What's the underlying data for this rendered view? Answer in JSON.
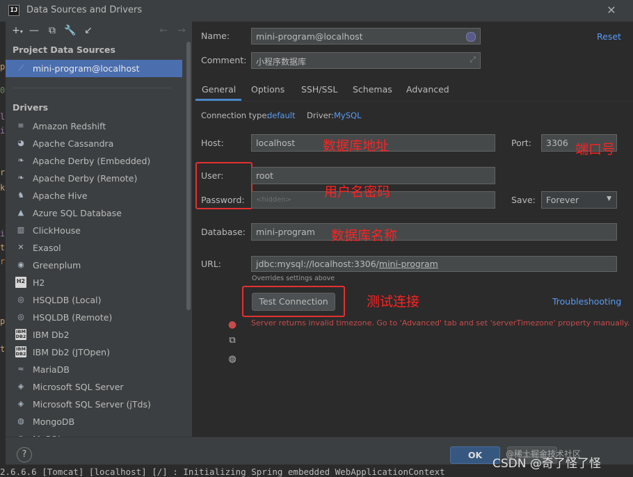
{
  "window": {
    "title": "Data Sources and Drivers",
    "logo": "IJ",
    "close_glyph": "✕"
  },
  "toolbar": {
    "add": "+",
    "add_arrow": "▾",
    "remove": "—",
    "copy": "⧉",
    "settings": "🔧",
    "import": "↙",
    "back": "←",
    "forward": "→"
  },
  "left": {
    "project_title": "Project Data Sources",
    "project_item": "mini-program@localhost",
    "drivers_title": "Drivers",
    "drivers": [
      {
        "label": "Amazon Redshift",
        "icon": "≡"
      },
      {
        "label": "Apache Cassandra",
        "icon": "◕"
      },
      {
        "label": "Apache Derby (Embedded)",
        "icon": "❧"
      },
      {
        "label": "Apache Derby (Remote)",
        "icon": "❧"
      },
      {
        "label": "Apache Hive",
        "icon": "♞"
      },
      {
        "label": "Azure SQL Database",
        "icon": "▲"
      },
      {
        "label": "ClickHouse",
        "icon": "▥"
      },
      {
        "label": "Exasol",
        "icon": "✕"
      },
      {
        "label": "Greenplum",
        "icon": "◉"
      },
      {
        "label": "H2",
        "icon": "H2"
      },
      {
        "label": "HSQLDB (Local)",
        "icon": "◎"
      },
      {
        "label": "HSQLDB (Remote)",
        "icon": "◎"
      },
      {
        "label": "IBM Db2",
        "icon": "IBM DB2"
      },
      {
        "label": "IBM Db2 (JTOpen)",
        "icon": "IBM DB2"
      },
      {
        "label": "MariaDB",
        "icon": "≈"
      },
      {
        "label": "Microsoft SQL Server",
        "icon": "◈"
      },
      {
        "label": "Microsoft SQL Server (jTds)",
        "icon": "◈"
      },
      {
        "label": "MongoDB",
        "icon": "◍"
      },
      {
        "label": "MySQL",
        "icon": "◉"
      }
    ]
  },
  "form": {
    "name_label": "Name:",
    "name_value": "mini-program@localhost",
    "reset": "Reset",
    "comment_label": "Comment:",
    "comment_value": "小程序数据库",
    "tabs": [
      "General",
      "Options",
      "SSH/SSL",
      "Schemas",
      "Advanced"
    ],
    "conn_type_label": "Connection type:",
    "conn_type_value": "default",
    "driver_label": "Driver:",
    "driver_value": "MySQL",
    "host_label": "Host:",
    "host_value": "localhost",
    "port_label": "Port:",
    "port_value": "3306",
    "user_label": "User:",
    "user_value": "root",
    "password_label": "Password:",
    "password_value": "<hidden>",
    "save_label": "Save:",
    "save_value": "Forever",
    "database_label": "Database:",
    "database_value": "mini-program",
    "url_label": "URL:",
    "url_prefix": "jdbc:mysql://localhost:3306/",
    "url_db": "mini-program",
    "overrides": "Overrides settings above",
    "test_button": "Test Connection",
    "troubleshooting": "Troubleshooting",
    "error_message": "Server returns invalid timezone. Go to 'Advanced' tab and set 'serverTimezone' property manually."
  },
  "annotations": {
    "host": "数据库地址",
    "port": "端口号",
    "user_password": "用户名密码",
    "database": "数据库名称",
    "test": "测试连接"
  },
  "bottom": {
    "help": "?",
    "ok": "OK",
    "cancel": "Cancel",
    "watermark_small": "@稀土掘金技术社区",
    "watermark_large": "CSDN @奇了怪了怪"
  },
  "background": {
    "console_line": "2.6.6.6 [Tomcat] [localhost] [/]           : Initializing Spring embedded WebApplicationContext"
  },
  "colors": {
    "accent": "#4b6eaf",
    "link": "#589df6",
    "error": "#c84b4b",
    "annotation": "#ff2222"
  }
}
